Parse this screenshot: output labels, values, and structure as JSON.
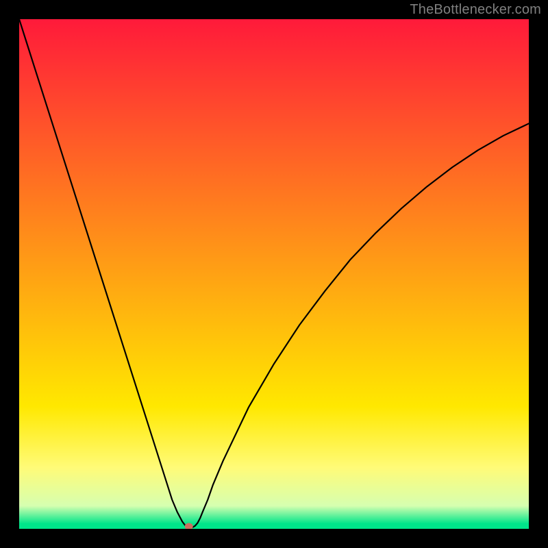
{
  "watermark": "TheBottlenecker.com",
  "chart_data": {
    "type": "line",
    "title": "",
    "xlabel": "",
    "ylabel": "",
    "xlim": [
      0,
      100
    ],
    "ylim": [
      0,
      105
    ],
    "x": [
      0,
      1,
      2,
      3,
      4,
      5,
      6,
      7,
      8,
      9,
      10,
      11,
      12,
      13,
      14,
      15,
      16,
      17,
      18,
      19,
      20,
      21,
      22,
      23,
      24,
      25,
      26,
      27,
      28,
      29,
      30,
      31,
      32,
      32.5,
      33,
      33.5,
      34,
      34.5,
      35,
      35.5,
      36,
      37,
      38,
      40,
      45,
      50,
      55,
      60,
      65,
      70,
      75,
      80,
      85,
      90,
      95,
      100
    ],
    "y": [
      105,
      101.7,
      98.4,
      95.1,
      91.8,
      88.5,
      85.2,
      81.9,
      78.6,
      75.3,
      72,
      68.7,
      65.4,
      62.1,
      58.8,
      55.5,
      52.2,
      48.9,
      45.6,
      42.3,
      39,
      35.7,
      32.4,
      29.1,
      25.8,
      22.5,
      19.2,
      15.9,
      12.6,
      9.3,
      6,
      3.5,
      1.5,
      0.8,
      0.3,
      0.3,
      0.3,
      0.6,
      1.2,
      2.2,
      3.5,
      6,
      9,
      14,
      25,
      34,
      42,
      49,
      55.5,
      61,
      66,
      70.5,
      74.5,
      78,
      81,
      83.5
    ],
    "marker": {
      "x": 33.3,
      "y": 0.5
    },
    "gradient_bands": [
      {
        "y0": 0.0,
        "y1": 0.76,
        "c0": "#ff1a3a",
        "c1": "#ffe800"
      },
      {
        "y0": 0.76,
        "y1": 0.88,
        "c0": "#ffe800",
        "c1": "#fffb78"
      },
      {
        "y0": 0.88,
        "y1": 0.955,
        "c0": "#fffb78",
        "c1": "#d6ffb0"
      },
      {
        "y0": 0.955,
        "y1": 0.99,
        "c0": "#d6ffb0",
        "c1": "#00e58a"
      },
      {
        "y0": 0.99,
        "y1": 1.0,
        "c0": "#00e58a",
        "c1": "#00e58a"
      }
    ]
  }
}
